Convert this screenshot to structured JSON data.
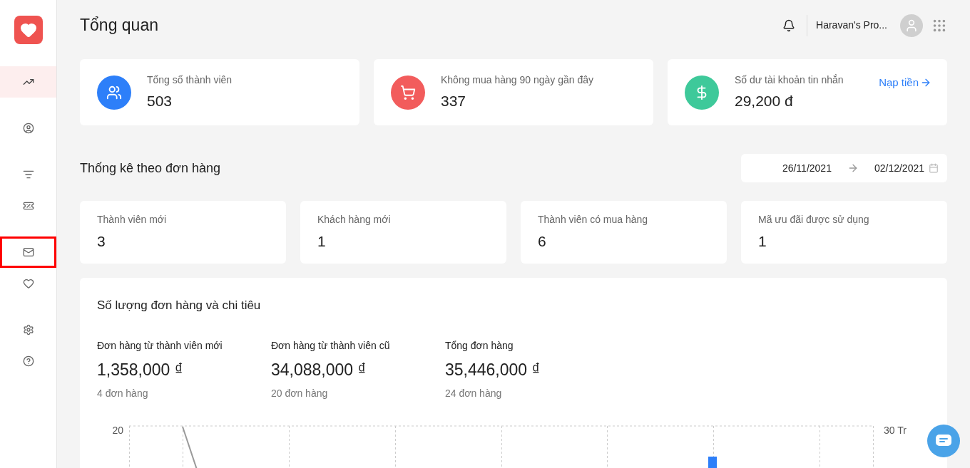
{
  "sidebar": {
    "items": [
      {
        "kind": "trend",
        "selected": true,
        "highlighted": false
      },
      {
        "kind": "user",
        "selected": false,
        "highlighted": false
      },
      {
        "kind": "filter",
        "selected": false,
        "highlighted": false
      },
      {
        "kind": "ticket",
        "selected": false,
        "highlighted": false
      },
      {
        "kind": "mail",
        "selected": false,
        "highlighted": true
      },
      {
        "kind": "heart",
        "selected": false,
        "highlighted": false
      },
      {
        "kind": "settings",
        "selected": false,
        "highlighted": false
      },
      {
        "kind": "help",
        "selected": false,
        "highlighted": false
      }
    ]
  },
  "header": {
    "title": "Tổng quan",
    "account": "Haravan's Pro..."
  },
  "summary_cards": [
    {
      "kind": "members",
      "color": "#2d7ff9",
      "label": "Tổng số thành viên",
      "value": "503"
    },
    {
      "kind": "cart",
      "color": "#f25c5c",
      "label": "Không mua hàng 90 ngày gần đây",
      "value": "337"
    },
    {
      "kind": "dollar",
      "color": "#3ec99a",
      "label": "Số dư tài khoản tin nhắn",
      "value": "29,200 đ",
      "link": "Nạp tiền"
    }
  ],
  "order_stats": {
    "title": "Thống kê theo đơn hàng",
    "date_from": "26/11/2021",
    "date_to": "02/12/2021",
    "cards": [
      {
        "label": "Thành viên mới",
        "value": "3"
      },
      {
        "label": "Khách hàng mới",
        "value": "1"
      },
      {
        "label": "Thành viên có mua hàng",
        "value": "6"
      },
      {
        "label": "Mã ưu đãi được sử dụng",
        "value": "1"
      }
    ]
  },
  "chart_panel": {
    "title": "Số lượng đơn hàng và chi tiêu",
    "metrics": [
      {
        "label": "Đơn hàng từ thành viên mới",
        "value": "1,358,000 ₫",
        "orders": "4 đơn hàng"
      },
      {
        "label": "Đơn hàng từ thành viên cũ",
        "value": "34,088,000 ₫",
        "orders": "20 đơn hàng"
      },
      {
        "label": "Tổng đơn hàng",
        "value": "35,446,000 ₫",
        "orders": "24 đơn hàng"
      }
    ],
    "left_axis_label": "20",
    "right_axis_label": "30 Tr"
  }
}
